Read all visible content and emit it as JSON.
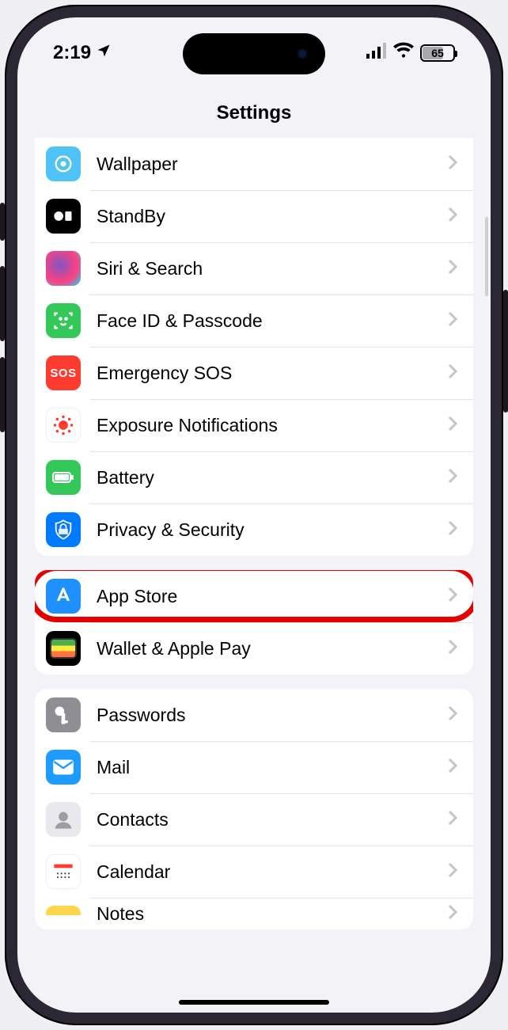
{
  "status": {
    "time": "2:19",
    "battery_pct": "65"
  },
  "nav": {
    "title": "Settings"
  },
  "groups": [
    {
      "rows": [
        {
          "id": "wallpaper",
          "label": "Wallpaper"
        },
        {
          "id": "standby",
          "label": "StandBy"
        },
        {
          "id": "siri",
          "label": "Siri & Search"
        },
        {
          "id": "faceid",
          "label": "Face ID & Passcode"
        },
        {
          "id": "sos",
          "label": "Emergency SOS"
        },
        {
          "id": "exposure",
          "label": "Exposure Notifications"
        },
        {
          "id": "battery",
          "label": "Battery"
        },
        {
          "id": "privacy",
          "label": "Privacy & Security"
        }
      ]
    },
    {
      "rows": [
        {
          "id": "appstore",
          "label": "App Store",
          "highlighted": true
        },
        {
          "id": "wallet",
          "label": "Wallet & Apple Pay"
        }
      ]
    },
    {
      "rows": [
        {
          "id": "passwords",
          "label": "Passwords"
        },
        {
          "id": "mail",
          "label": "Mail"
        },
        {
          "id": "contacts",
          "label": "Contacts"
        },
        {
          "id": "calendar",
          "label": "Calendar"
        },
        {
          "id": "notes",
          "label": "Notes"
        }
      ]
    }
  ],
  "sos_text": "SOS"
}
